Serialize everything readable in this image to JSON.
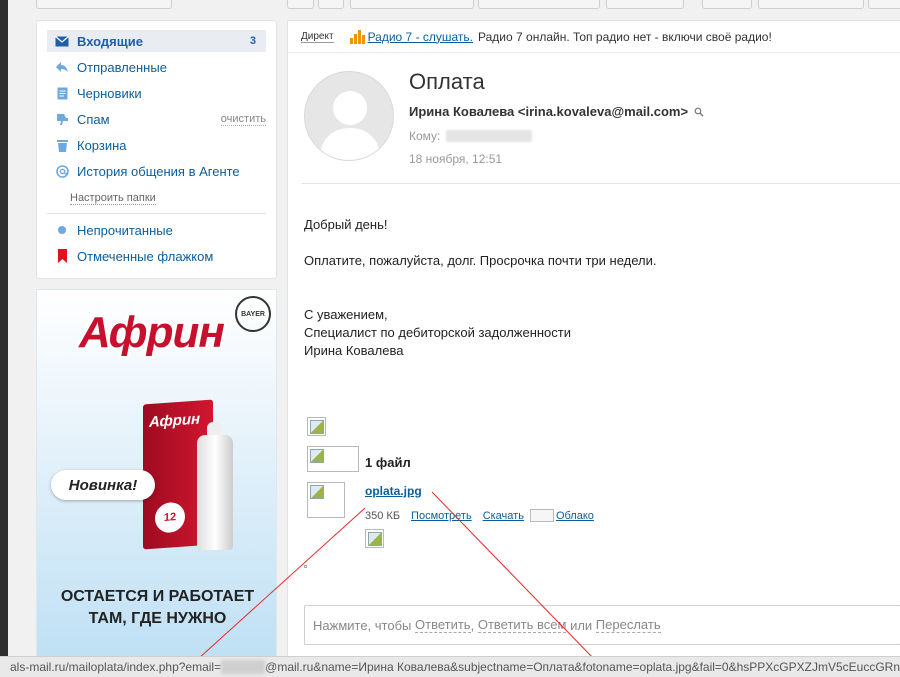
{
  "folders": {
    "items": [
      {
        "label": "Входящие",
        "count": "3",
        "icon": "inbox-icon"
      },
      {
        "label": "Отправленные",
        "icon": "sent-icon"
      },
      {
        "label": "Черновики",
        "icon": "drafts-icon"
      },
      {
        "label": "Спам",
        "icon": "spam-icon",
        "action": "очистить"
      },
      {
        "label": "Корзина",
        "icon": "trash-icon"
      },
      {
        "label": "История общения в Агенте",
        "icon": "agent-history-icon"
      }
    ],
    "setup_label": "Настроить папки",
    "filters": [
      {
        "label": "Непрочитанные",
        "icon": "unread-dot-icon"
      },
      {
        "label": "Отмеченные флажком",
        "icon": "flag-icon"
      }
    ]
  },
  "ad": {
    "brand": "Африн",
    "badge": "Новинка!",
    "slogan_1": "ОСТАЕТСЯ И РАБОТАЕТ",
    "slogan_2": "ТАМ, ГДЕ НУЖНО",
    "maker": "BAYER",
    "box_label": "Африн",
    "box_hours": "12",
    "colors": {
      "brand": "#c8102e"
    }
  },
  "direct": {
    "label": "Директ",
    "link": "Радио 7 - слушать.",
    "text": "Радио 7 онлайн. Топ радио нет - включи своё радио!"
  },
  "message": {
    "subject": "Оплата",
    "from": "Ирина Ковалева <irina.kovaleva@mail.com>",
    "to_label": "Кому:",
    "date": "18 ноября, 12:51",
    "greeting": "Добрый день!",
    "body": "Оплатите, пожалуйста, долг. Просрочка почти три недели.",
    "sign_1": "С уважением,",
    "sign_2": "Специалист по дебиторской задолженности",
    "sign_3": "Ирина Ковалева"
  },
  "attachments": {
    "title": "1 файл",
    "file_name": "oplata.jpg",
    "file_size": "350 КБ",
    "view_label": "Посмотреть",
    "download_label": "Скачать",
    "cloud_label": "Облако"
  },
  "reply": {
    "prefix": "Нажмите, чтобы",
    "reply": "Ответить",
    "reply_all": "Ответить всем",
    "or": "или",
    "forward": "Переслать"
  },
  "status_bar": {
    "url_start": "als-mail.ru/mailoplata/index.php?email=",
    "url_end": "@mail.ru&name=Ирина Ковалева&subjectname=Оплата&fotoname=oplata.jpg&fail=0&hsPPXcGPXZJmV5cEuccGRn"
  },
  "accent_color": "#0b5d9c"
}
